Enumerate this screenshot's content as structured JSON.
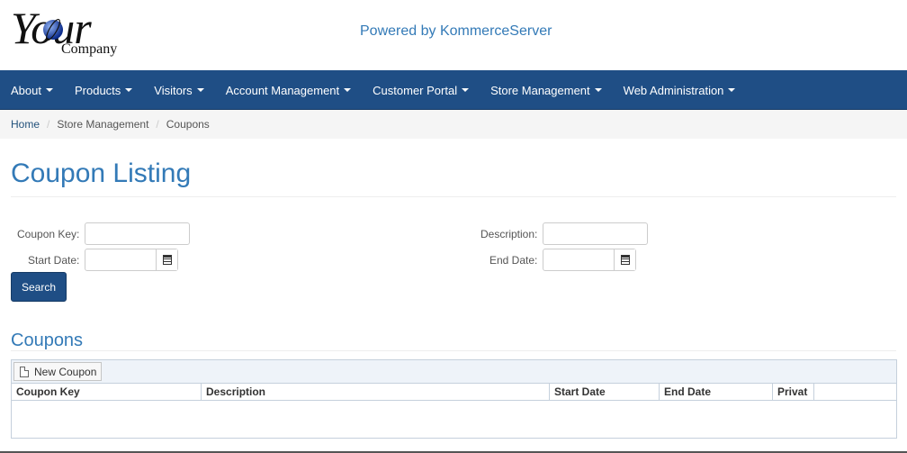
{
  "header": {
    "logo_word": "Your",
    "logo_sub": "Company",
    "powered_text": "Powered by KommerceServer"
  },
  "nav": {
    "items": [
      {
        "label": "About"
      },
      {
        "label": "Products"
      },
      {
        "label": "Visitors"
      },
      {
        "label": "Account Management"
      },
      {
        "label": "Customer Portal"
      },
      {
        "label": "Store Management"
      },
      {
        "label": "Web Administration"
      }
    ]
  },
  "breadcrumb": {
    "home": "Home",
    "section": "Store Management",
    "current": "Coupons"
  },
  "page": {
    "title": "Coupon Listing"
  },
  "form": {
    "coupon_key_label": "Coupon Key:",
    "coupon_key_value": "",
    "description_label": "Description:",
    "description_value": "",
    "start_date_label": "Start Date:",
    "start_date_value": "",
    "end_date_label": "End Date:",
    "end_date_value": "",
    "search_label": "Search"
  },
  "coupons": {
    "title": "Coupons",
    "new_button_label": "New Coupon",
    "columns": [
      "Coupon Key",
      "Description",
      "Start Date",
      "End Date",
      "Privat"
    ],
    "rows": []
  },
  "colors": {
    "navbar": "#1f4e85",
    "accent": "#337ab7"
  }
}
